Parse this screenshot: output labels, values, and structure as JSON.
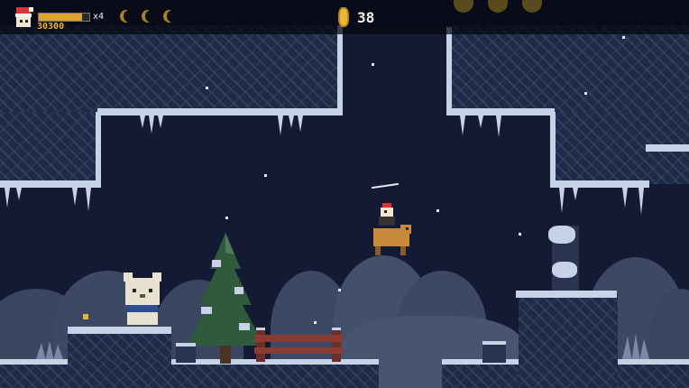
{
  "hud": {
    "lives": "x4",
    "score": "30300",
    "coins": "38",
    "health_fraction": 0.85,
    "moons_collected": 3,
    "big_coins_slots": 3
  },
  "colors": {
    "sky": "#141a33",
    "rock": "#1f2a45",
    "snow": "#c7d2e6",
    "coin": "#e8b830",
    "health": "#e0a330"
  },
  "icons": {
    "player_portrait": "santa-hat-player-icon",
    "coin": "gold-coin-icon",
    "moon": "crescent-moon-icon"
  }
}
